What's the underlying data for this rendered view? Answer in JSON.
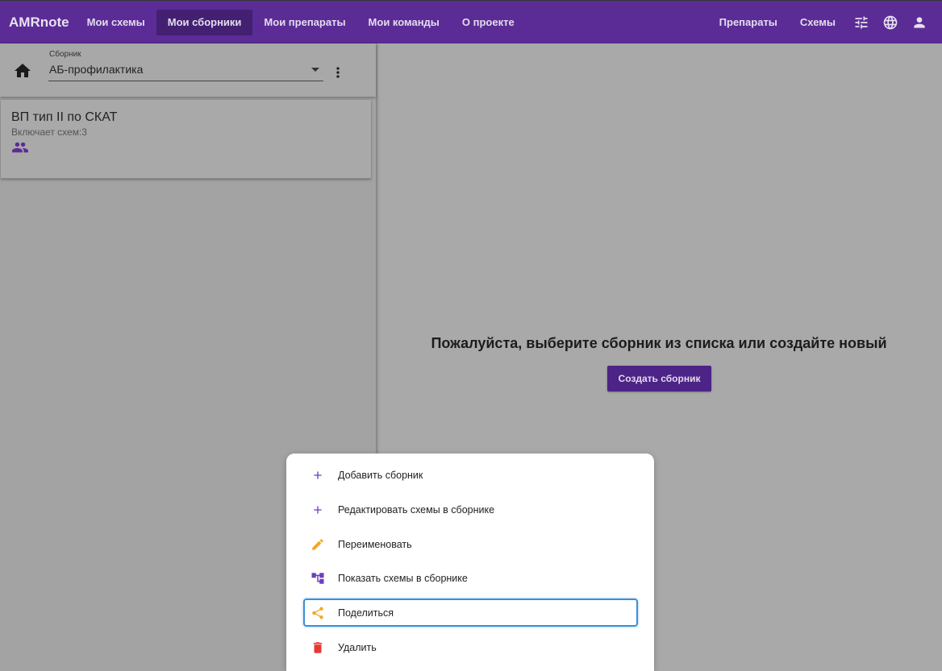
{
  "header": {
    "brand": "AMRnote",
    "nav": [
      {
        "label": "Мои схемы"
      },
      {
        "label": "Мои сборники",
        "active": true
      },
      {
        "label": "Мои препараты"
      },
      {
        "label": "Мои команды"
      },
      {
        "label": "О проекте"
      }
    ],
    "right_nav": [
      {
        "label": "Препараты"
      },
      {
        "label": "Схемы"
      }
    ],
    "icons": [
      "tune-icon",
      "globe-icon",
      "account-icon"
    ]
  },
  "selector": {
    "label": "Сборник",
    "value": "АБ-профилактика"
  },
  "collection_card": {
    "title": "ВП тип II по СКАТ",
    "subtitle": "Включает схем:3",
    "icon": "group-icon"
  },
  "main": {
    "message": "Пожалуйста, выберите сборник из списка или создайте новый",
    "create_button": "Создать сборник"
  },
  "context_menu": {
    "items": [
      {
        "label": "Добавить сборник",
        "icon": "plus-icon",
        "color": "#6a3fc0"
      },
      {
        "label": "Редактировать схемы в сборнике",
        "icon": "plus-icon",
        "color": "#6a3fc0"
      },
      {
        "label": "Переименовать",
        "icon": "pencil-icon",
        "color": "#f5a623"
      },
      {
        "label": "Показать схемы в сборнике",
        "icon": "tree-icon",
        "color": "#6a3fc0"
      },
      {
        "label": "Поделиться",
        "icon": "share-icon",
        "color": "#f5a623",
        "focused": true
      },
      {
        "label": "Удалить",
        "icon": "trash-icon",
        "color": "#e53935"
      }
    ]
  },
  "colors": {
    "primary": "#5b2c95",
    "primary_dark": "#432072",
    "button": "#4c2386",
    "focus": "#3b8fd9"
  }
}
